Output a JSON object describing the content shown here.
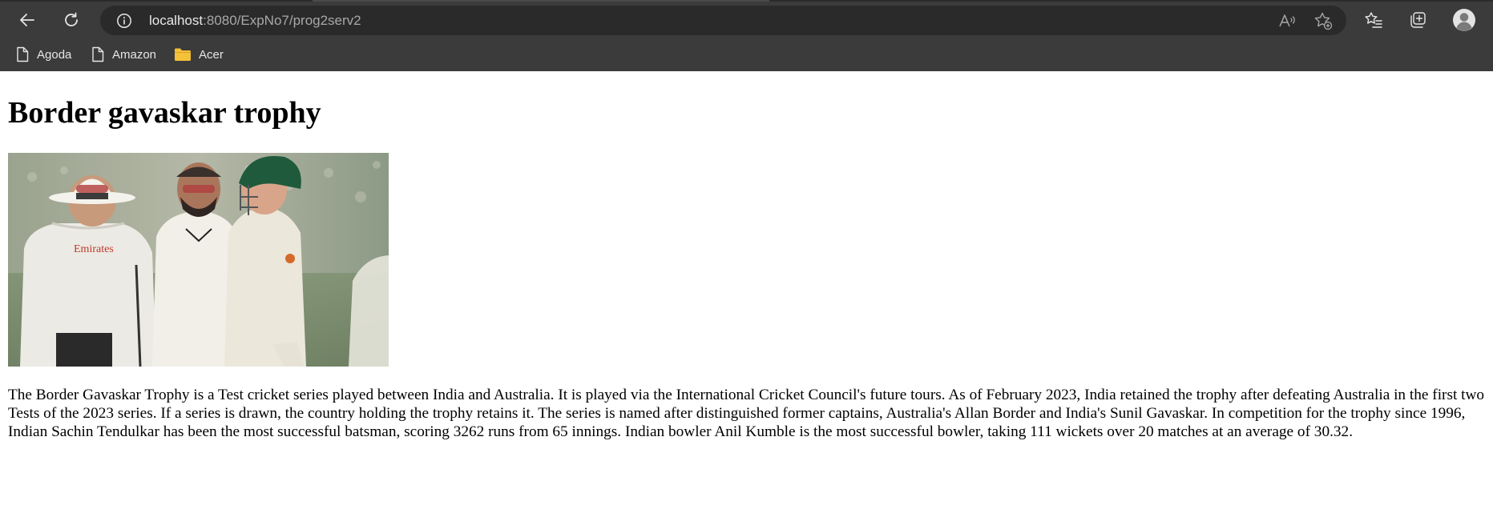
{
  "browser": {
    "url_host": "localhost",
    "url_path": ":8080/ExpNo7/prog2serv2",
    "bookmarks": [
      {
        "label": "Agoda",
        "icon": "page-icon"
      },
      {
        "label": "Amazon",
        "icon": "page-icon"
      },
      {
        "label": "Acer",
        "icon": "folder-icon"
      }
    ],
    "colors": {
      "chrome": "#3b3b3b",
      "omnibox": "#2a2a2a",
      "folder": "#f3c13a"
    }
  },
  "page": {
    "heading": "Border gavaskar trophy",
    "image": {
      "printed_text": "Emirates"
    },
    "paragraph": "The Border Gavaskar Trophy is a Test cricket series played between India and Australia. It is played via the International Cricket Council's future tours. As of February 2023, India retained the trophy after defeating Australia in the first two Tests of the 2023 series. If a series is drawn, the country holding the trophy retains it. The series is named after distinguished former captains, Australia's Allan Border and India's Sunil Gavaskar. In competition for the trophy since 1996, Indian Sachin Tendulkar has been the most successful batsman, scoring 3262 runs from 65 innings. Indian bowler Anil Kumble is the most successful bowler, taking 111 wickets over 20 matches at an average of 30.32."
  }
}
